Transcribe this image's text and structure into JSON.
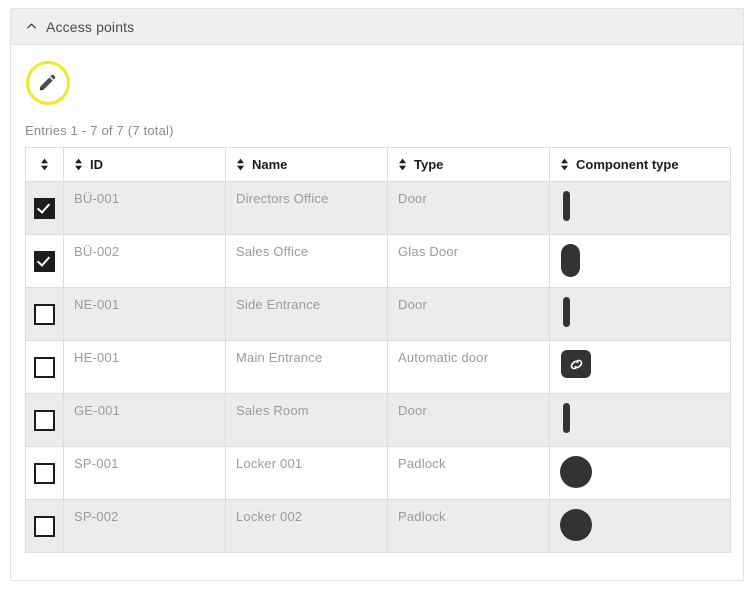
{
  "panel": {
    "title": "Access points",
    "collapse_icon": "chevron-up-icon",
    "collapsed": false
  },
  "toolbar": {
    "edit_button": {
      "icon": "pencil-icon",
      "label": "Edit",
      "ring_color": "#f2e52b"
    }
  },
  "table": {
    "entries_info": "Entries 1 - 7 of 7 (7 total)",
    "sort_icon": "sort-updown-icon",
    "columns": [
      {
        "key": "select",
        "label": ""
      },
      {
        "key": "id",
        "label": "ID"
      },
      {
        "key": "name",
        "label": "Name"
      },
      {
        "key": "type",
        "label": "Type"
      },
      {
        "key": "component_type",
        "label": "Component type"
      }
    ],
    "rows": [
      {
        "selected": true,
        "id": "BÜ-001",
        "name": "Directors Office",
        "type": "Door",
        "component_icon": "door-icon"
      },
      {
        "selected": true,
        "id": "BÜ-002",
        "name": "Sales Office",
        "type": "Glas Door",
        "component_icon": "glas-door-icon"
      },
      {
        "selected": false,
        "id": "NE-001",
        "name": "Side Entrance",
        "type": "Door",
        "component_icon": "door-icon"
      },
      {
        "selected": false,
        "id": "HE-001",
        "name": "Main Entrance",
        "type": "Automatic door",
        "component_icon": "automatic-door-icon"
      },
      {
        "selected": false,
        "id": "GE-001",
        "name": "Sales Room",
        "type": "Door",
        "component_icon": "door-icon"
      },
      {
        "selected": false,
        "id": "SP-001",
        "name": "Locker 001",
        "type": "Padlock",
        "component_icon": "padlock-icon"
      },
      {
        "selected": false,
        "id": "SP-002",
        "name": "Locker 002",
        "type": "Padlock",
        "component_icon": "padlock-icon"
      }
    ]
  },
  "colors": {
    "accent": "#f2e52b",
    "header_bg": "#efefef",
    "row_alt_bg": "#ececec",
    "icon_dark": "#333333",
    "text_muted": "#9b9b9b"
  }
}
